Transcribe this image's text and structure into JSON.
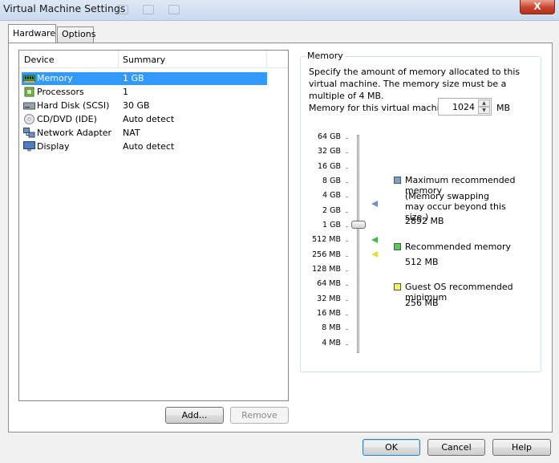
{
  "window": {
    "title": "Virtual Machine Settings",
    "close_glyph": "X"
  },
  "tabs": [
    {
      "label": "Hardware",
      "active": true
    },
    {
      "label": "Options",
      "active": false
    }
  ],
  "device_list": {
    "columns": [
      "Device",
      "Summary"
    ],
    "rows": [
      {
        "icon": "memory-icon",
        "device": "Memory",
        "summary": "1 GB",
        "selected": true
      },
      {
        "icon": "processor-icon",
        "device": "Processors",
        "summary": "1",
        "selected": false
      },
      {
        "icon": "hard-disk-icon",
        "device": "Hard Disk (SCSI)",
        "summary": "30 GB",
        "selected": false
      },
      {
        "icon": "cd-dvd-icon",
        "device": "CD/DVD (IDE)",
        "summary": "Auto detect",
        "selected": false
      },
      {
        "icon": "network-adapter-icon",
        "device": "Network Adapter",
        "summary": "NAT",
        "selected": false
      },
      {
        "icon": "display-icon",
        "device": "Display",
        "summary": "Auto detect",
        "selected": false
      }
    ],
    "add_button": "Add...",
    "remove_button": "Remove"
  },
  "memory": {
    "group_label": "Memory",
    "description": "Specify the amount of memory allocated to this virtual machine. The memory size must be a multiple of 4 MB.",
    "field_label": "Memory for this virtual machine:",
    "value": "1024",
    "unit": "MB",
    "scale_labels": [
      "64 GB",
      "32 GB",
      "16 GB",
      "8 GB",
      "4 GB",
      "2 GB",
      "1 GB",
      "512 MB",
      "256 MB",
      "128 MB",
      "64 MB",
      "32 MB",
      "16 MB",
      "8 MB",
      "4 MB"
    ],
    "legend": {
      "max": {
        "label": "Maximum recommended memory",
        "note": "(Memory swapping may occur beyond this size.)",
        "value": "2892 MB",
        "color": "#7f9fc8"
      },
      "recommended": {
        "label": "Recommended memory",
        "value": "512 MB",
        "color": "#5cc65c"
      },
      "guest_min": {
        "label": "Guest OS recommended minimum",
        "value": "256 MB",
        "color": "#f5f06a"
      }
    }
  },
  "footer": {
    "ok": "OK",
    "cancel": "Cancel",
    "help": "Help"
  }
}
